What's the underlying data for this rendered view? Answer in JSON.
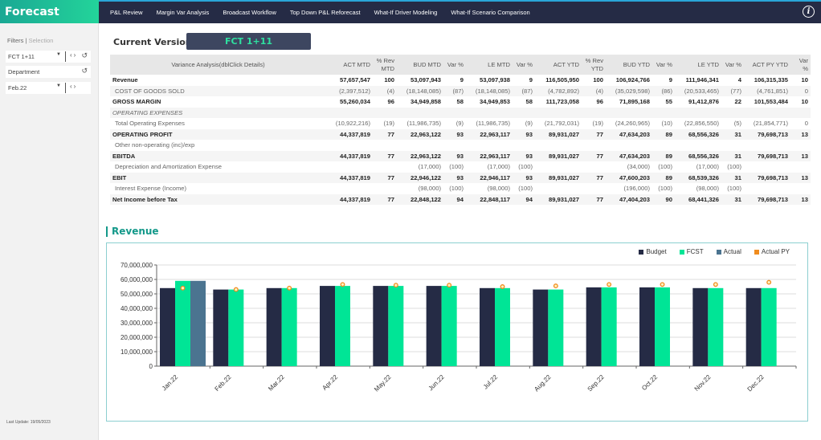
{
  "app": {
    "title": "Forecast"
  },
  "nav": {
    "items": [
      "P&L Review",
      "Margin Var Analysis",
      "Broadcast Workflow",
      "Top Down P&L Reforecast",
      "What-If Driver Modeling",
      "What-If Scenario Comparison"
    ],
    "info_icon": "info-icon"
  },
  "sidebar": {
    "filters_label": "Filters",
    "separator": "|",
    "selection_label": "Selection",
    "version_value": "FCT 1+11",
    "department_label": "Department",
    "period_value": "Feb.22",
    "last_update": "Last Update: 19/05/2023"
  },
  "main": {
    "current_version_label": "Current Version",
    "current_version_value": "FCT 1+11"
  },
  "table": {
    "headers": [
      "Variance Analysis(dblClick Details)",
      "ACT MTD",
      "% Rev MTD",
      "BUD MTD",
      "Var %",
      "LE MTD",
      "Var %",
      "ACT YTD",
      "% Rev YTD",
      "BUD YTD",
      "Var %",
      "LE YTD",
      "Var %",
      "ACT PY YTD",
      "Var %"
    ],
    "rows": [
      {
        "style": "bold",
        "cells": [
          "Revenue",
          "57,657,547",
          "100",
          "53,097,943",
          "9",
          "53,097,938",
          "9",
          "116,505,950",
          "100",
          "106,924,766",
          "9",
          "111,946,341",
          "4",
          "106,315,335",
          "10"
        ]
      },
      {
        "style": "ind",
        "cells": [
          "COST OF GOODS SOLD",
          "(2,397,512)",
          "(4)",
          "(18,148,085)",
          "(87)",
          "(18,148,085)",
          "(87)",
          "(4,782,892)",
          "(4)",
          "(35,029,598)",
          "(86)",
          "(20,533,465)",
          "(77)",
          "(4,761,851)",
          "0"
        ]
      },
      {
        "style": "bold",
        "cells": [
          "GROSS MARGIN",
          "55,260,034",
          "96",
          "34,949,858",
          "58",
          "34,949,853",
          "58",
          "111,723,058",
          "96",
          "71,895,168",
          "55",
          "91,412,876",
          "22",
          "101,553,484",
          "10"
        ]
      },
      {
        "style": "ital",
        "cells": [
          "OPERATING EXPENSES",
          "",
          "",
          "",
          "",
          "",
          "",
          "",
          "",
          "",
          "",
          "",
          "",
          "",
          ""
        ]
      },
      {
        "style": "ind",
        "cells": [
          "Total Operating Expenses",
          "(10,922,216)",
          "(19)",
          "(11,986,735)",
          "(9)",
          "(11,986,735)",
          "(9)",
          "(21,792,031)",
          "(19)",
          "(24,260,965)",
          "(10)",
          "(22,856,550)",
          "(5)",
          "(21,854,771)",
          "0"
        ]
      },
      {
        "style": "bold",
        "cells": [
          "OPERATING PROFIT",
          "44,337,819",
          "77",
          "22,963,122",
          "93",
          "22,963,117",
          "93",
          "89,931,027",
          "77",
          "47,634,203",
          "89",
          "68,556,326",
          "31",
          "79,698,713",
          "13"
        ]
      },
      {
        "style": "ind",
        "cells": [
          "Other non-operating (inc)/exp",
          "",
          "",
          "",
          "",
          "",
          "",
          "",
          "",
          "",
          "",
          "",
          "",
          "",
          ""
        ]
      },
      {
        "style": "bold",
        "cells": [
          "EBITDA",
          "44,337,819",
          "77",
          "22,963,122",
          "93",
          "22,963,117",
          "93",
          "89,931,027",
          "77",
          "47,634,203",
          "89",
          "68,556,326",
          "31",
          "79,698,713",
          "13"
        ]
      },
      {
        "style": "ind",
        "cells": [
          "Depreciation and Amortization Expense",
          "",
          "",
          "(17,000)",
          "(100)",
          "(17,000)",
          "(100)",
          "",
          "",
          "(34,000)",
          "(100)",
          "(17,000)",
          "(100)",
          "",
          ""
        ]
      },
      {
        "style": "bold",
        "cells": [
          "EBIT",
          "44,337,819",
          "77",
          "22,946,122",
          "93",
          "22,946,117",
          "93",
          "89,931,027",
          "77",
          "47,600,203",
          "89",
          "68,539,326",
          "31",
          "79,698,713",
          "13"
        ]
      },
      {
        "style": "ind",
        "cells": [
          "Interest Expense (Income)",
          "",
          "",
          "(98,000)",
          "(100)",
          "(98,000)",
          "(100)",
          "",
          "",
          "(196,000)",
          "(100)",
          "(98,000)",
          "(100)",
          "",
          ""
        ]
      },
      {
        "style": "bold",
        "cells": [
          "Net Income before Tax",
          "44,337,819",
          "77",
          "22,848,122",
          "94",
          "22,848,117",
          "94",
          "89,931,027",
          "77",
          "47,404,203",
          "90",
          "68,441,326",
          "31",
          "79,698,713",
          "13"
        ]
      }
    ]
  },
  "chart_section": {
    "title": "Revenue"
  },
  "chart_data": {
    "type": "bar",
    "title": "Revenue",
    "categories": [
      "Jan.22",
      "Feb.22",
      "Mar.22",
      "Apr.22",
      "May.22",
      "Jun.22",
      "Jul.22",
      "Aug.22",
      "Sep.22",
      "Oct.22",
      "Nov.22",
      "Dec.22"
    ],
    "series": [
      {
        "name": "Budget",
        "kind": "bar",
        "color": "#252b45",
        "values": [
          54000000,
          53000000,
          54000000,
          55500000,
          55500000,
          55500000,
          54000000,
          53000000,
          54500000,
          54500000,
          54000000,
          54000000
        ]
      },
      {
        "name": "FCST",
        "kind": "bar",
        "color": "#00e596",
        "values": [
          59000000,
          53000000,
          54000000,
          55500000,
          55500000,
          55500000,
          54000000,
          53000000,
          54500000,
          54500000,
          54000000,
          54000000
        ]
      },
      {
        "name": "Actual",
        "kind": "bar",
        "color": "#4b7490",
        "values": [
          59000000,
          null,
          null,
          null,
          null,
          null,
          null,
          null,
          null,
          null,
          null,
          null
        ]
      },
      {
        "name": "Actual PY",
        "kind": "marker",
        "color": "#f08c1e",
        "values": [
          54000000,
          53000000,
          54000000,
          56500000,
          56000000,
          56000000,
          55000000,
          55500000,
          56500000,
          56500000,
          56500000,
          58000000
        ]
      }
    ],
    "yticks": [
      "0",
      "10,000,000",
      "20,000,000",
      "30,000,000",
      "40,000,000",
      "50,000,000",
      "60,000,000",
      "70,000,000"
    ],
    "ylim": [
      0,
      70000000
    ],
    "xlabel": "",
    "ylabel": "",
    "grid": true,
    "legend_position": "top-right"
  }
}
